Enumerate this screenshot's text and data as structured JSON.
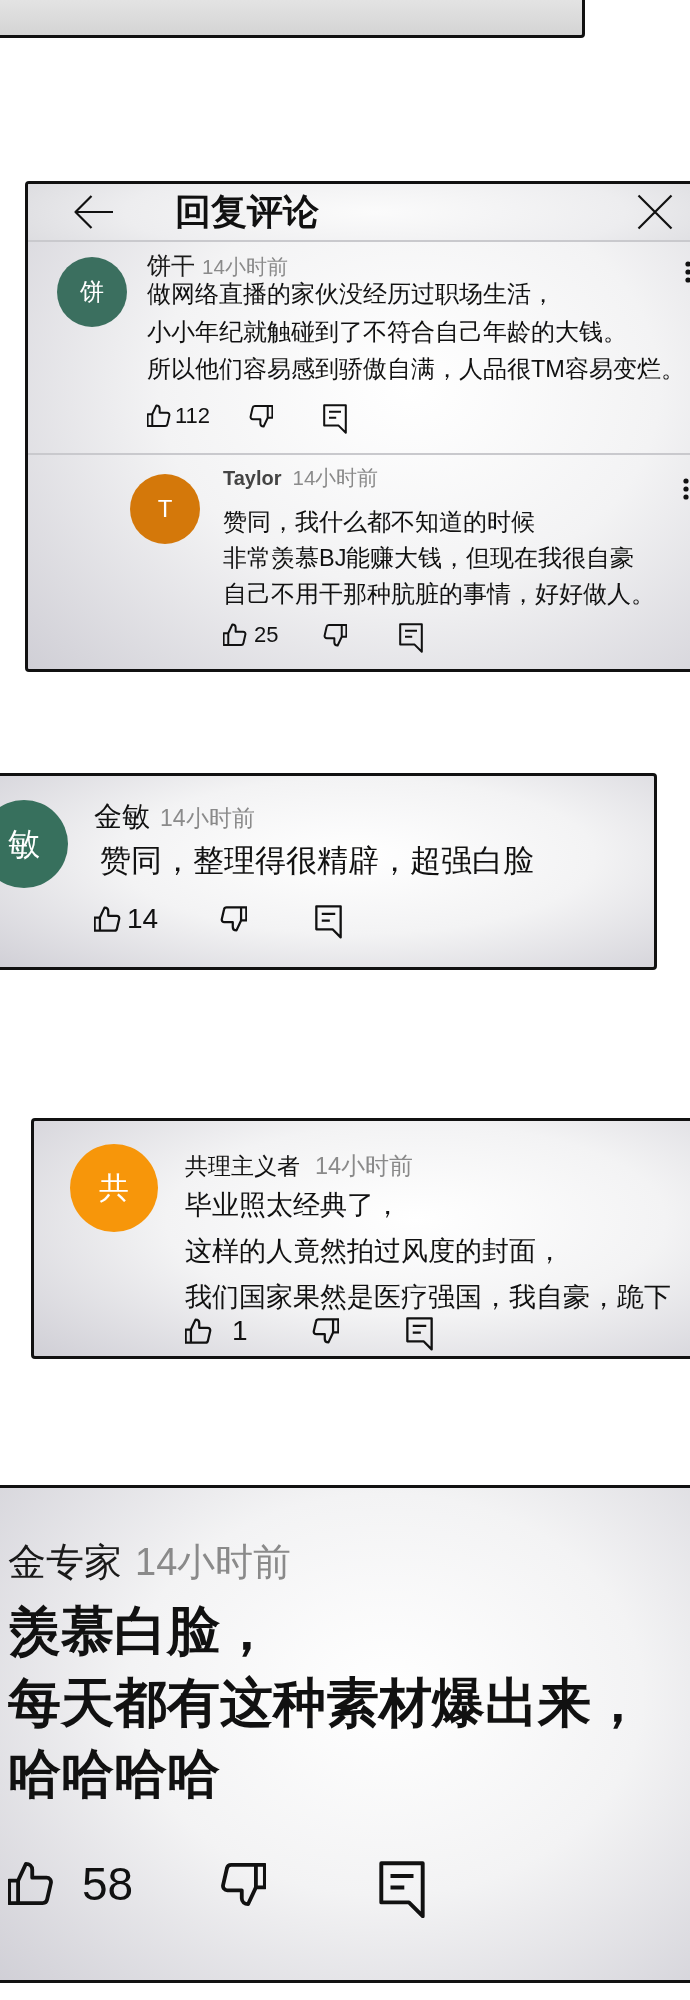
{
  "panels": [
    {
      "kind": "blank"
    },
    {
      "kind": "reply_dialog",
      "header": {
        "title": "回复评论"
      },
      "comment": {
        "avatar": {
          "initial": "饼",
          "color": "#3b6f5f"
        },
        "author": "饼干",
        "time": "14小时前",
        "lines": [
          "做网络直播的家伙没经历过职场生活，",
          "小小年纪就触碰到了不符合自己年龄的大钱。",
          "所以他们容易感到骄傲自满，人品很TM容易变烂。"
        ],
        "likes": "112"
      },
      "replies": [
        {
          "avatar": {
            "initial": "T",
            "color": "#d4780a"
          },
          "author": "Taylor",
          "time": "14小时前",
          "lines": [
            "赞同，我什么都不知道的时候",
            "非常羡慕BJ能赚大钱，但现在我很自豪",
            "自己不用干那种肮脏的事情，好好做人。"
          ],
          "likes": "25"
        }
      ]
    },
    {
      "kind": "comment",
      "comment": {
        "avatar": {
          "initial": "敏",
          "color": "#37705d"
        },
        "author": "金敏",
        "time": "14小时前",
        "lines": [
          "赞同，整理得很精辟，超强白脸"
        ],
        "likes": "14"
      }
    },
    {
      "kind": "comment",
      "comment": {
        "avatar": {
          "initial": "共",
          "color": "#f7960a"
        },
        "author": "共理主义者",
        "time": "14小时前",
        "lines": [
          "毕业照太经典了，",
          "这样的人竟然拍过风度的封面，",
          "我们国家果然是医疗强国，我自豪，跪下"
        ],
        "likes": "1"
      }
    },
    {
      "kind": "comment",
      "comment": {
        "author": "金专家",
        "time": "14小时前",
        "lines": [
          "羡慕白脸，",
          "每天都有这种素材爆出来，",
          "哈哈哈哈"
        ],
        "likes": "58"
      }
    }
  ]
}
